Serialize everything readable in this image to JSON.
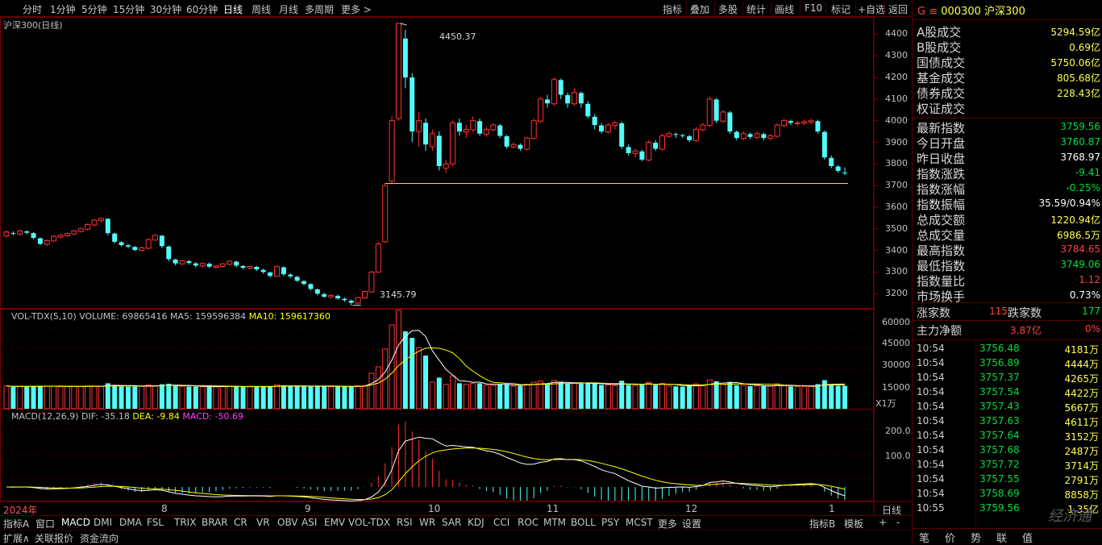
{
  "toolbar": {
    "periods": [
      "分时",
      "1分钟",
      "5分钟",
      "15分钟",
      "30分钟",
      "60分钟",
      "日线",
      "周线",
      "月线",
      "多周期",
      "更多"
    ],
    "active_period": "日线",
    "right_items": [
      "指标",
      "叠加",
      "多股",
      "统计",
      "画线",
      "F10",
      "标记",
      "+自选",
      "返回"
    ]
  },
  "chart": {
    "title": "沪深300(日线)",
    "high_label": "4450.37",
    "low_label": "3145.79",
    "price_ticks": [
      "4400",
      "4300",
      "4200",
      "4100",
      "4000",
      "3900",
      "3800",
      "3700",
      "3600",
      "3500",
      "3400",
      "3300",
      "3200"
    ],
    "vol_label": "VOL-TDX(5,10)",
    "vol_value": "VOLUME: 69865416",
    "ma5": "MA5: 159596384",
    "ma10": "MA10: 159617360",
    "vol_ticks": [
      "60000",
      "45000",
      "30000",
      "15000"
    ],
    "vol_unit": "X1万",
    "macd_label": "MACD(12,26,9)",
    "dif": "DIF: -35.18",
    "dea": "DEA: -9.84",
    "macd": "MACD: -50.69",
    "macd_ticks": [
      "200.0",
      "100.0"
    ],
    "x_labels": [
      "2024年",
      "8",
      "9",
      "10",
      "11",
      "12",
      "1"
    ],
    "x_period": "日线"
  },
  "chart_data": {
    "type": "candlestick",
    "ylim": [
      3100,
      4500
    ],
    "candles": [
      [
        3468,
        3485,
        3458,
        3492
      ],
      [
        3480,
        3478,
        3470,
        3488
      ],
      [
        3476,
        3490,
        3468,
        3495
      ],
      [
        3488,
        3482,
        3474,
        3492
      ],
      [
        3480,
        3458,
        3452,
        3484
      ],
      [
        3456,
        3430,
        3425,
        3460
      ],
      [
        3428,
        3445,
        3420,
        3450
      ],
      [
        3444,
        3465,
        3440,
        3470
      ],
      [
        3462,
        3470,
        3456,
        3476
      ],
      [
        3468,
        3478,
        3462,
        3482
      ],
      [
        3476,
        3490,
        3470,
        3495
      ],
      [
        3488,
        3500,
        3482,
        3505
      ],
      [
        3498,
        3520,
        3492,
        3525
      ],
      [
        3518,
        3540,
        3512,
        3545
      ],
      [
        3538,
        3548,
        3530,
        3552
      ],
      [
        3546,
        3480,
        3470,
        3550
      ],
      [
        3478,
        3440,
        3432,
        3482
      ],
      [
        3438,
        3425,
        3418,
        3442
      ],
      [
        3424,
        3418,
        3410,
        3430
      ],
      [
        3416,
        3402,
        3396,
        3420
      ],
      [
        3400,
        3412,
        3394,
        3418
      ],
      [
        3410,
        3450,
        3406,
        3455
      ],
      [
        3448,
        3470,
        3444,
        3475
      ],
      [
        3468,
        3420,
        3410,
        3472
      ],
      [
        3418,
        3360,
        3350,
        3422
      ],
      [
        3358,
        3340,
        3330,
        3362
      ],
      [
        3338,
        3352,
        3330,
        3356
      ],
      [
        3350,
        3342,
        3334,
        3356
      ],
      [
        3340,
        3330,
        3322,
        3346
      ],
      [
        3328,
        3340,
        3322,
        3344
      ],
      [
        3338,
        3325,
        3318,
        3344
      ],
      [
        3322,
        3328,
        3316,
        3332
      ],
      [
        3326,
        3338,
        3320,
        3342
      ],
      [
        3336,
        3350,
        3330,
        3355
      ],
      [
        3348,
        3330,
        3322,
        3352
      ],
      [
        3328,
        3320,
        3312,
        3332
      ],
      [
        3318,
        3326,
        3312,
        3330
      ],
      [
        3324,
        3312,
        3305,
        3328
      ],
      [
        3310,
        3300,
        3292,
        3316
      ],
      [
        3298,
        3282,
        3276,
        3302
      ],
      [
        3280,
        3325,
        3276,
        3330
      ],
      [
        3322,
        3290,
        3282,
        3326
      ],
      [
        3288,
        3280,
        3272,
        3294
      ],
      [
        3278,
        3260,
        3254,
        3282
      ],
      [
        3258,
        3245,
        3238,
        3262
      ],
      [
        3244,
        3222,
        3214,
        3248
      ],
      [
        3220,
        3200,
        3192,
        3224
      ],
      [
        3198,
        3186,
        3180,
        3204
      ],
      [
        3185,
        3192,
        3178,
        3198
      ],
      [
        3190,
        3178,
        3172,
        3196
      ],
      [
        3176,
        3170,
        3162,
        3182
      ],
      [
        3168,
        3158,
        3146,
        3172
      ],
      [
        3156,
        3182,
        3150,
        3186
      ],
      [
        3180,
        3210,
        3176,
        3214
      ],
      [
        3208,
        3300,
        3204,
        3305
      ],
      [
        3300,
        3430,
        3296,
        3440
      ],
      [
        3440,
        3700,
        3436,
        3710
      ],
      [
        3720,
        4000,
        3710,
        4020
      ],
      [
        4010,
        4450,
        4000,
        4450
      ],
      [
        4380,
        4200,
        4150,
        4420
      ],
      [
        4200,
        3950,
        3900,
        4220
      ],
      [
        3950,
        4000,
        3880,
        4040
      ],
      [
        3990,
        3890,
        3860,
        4010
      ],
      [
        3880,
        3940,
        3860,
        3960
      ],
      [
        3930,
        3790,
        3770,
        3950
      ],
      [
        3780,
        3800,
        3760,
        3820
      ],
      [
        3800,
        3990,
        3790,
        4000
      ],
      [
        3990,
        3950,
        3930,
        4010
      ],
      [
        3948,
        3960,
        3920,
        3980
      ],
      [
        3958,
        4000,
        3945,
        4020
      ],
      [
        3998,
        3940,
        3930,
        4010
      ],
      [
        3938,
        3960,
        3925,
        3970
      ],
      [
        3958,
        3980,
        3948,
        3990
      ],
      [
        3978,
        3930,
        3920,
        3985
      ],
      [
        3928,
        3880,
        3870,
        3935
      ],
      [
        3878,
        3890,
        3872,
        3900
      ],
      [
        3888,
        3870,
        3860,
        3895
      ],
      [
        3868,
        3920,
        3862,
        3925
      ],
      [
        3918,
        4000,
        3912,
        4010
      ],
      [
        3998,
        4100,
        3990,
        4110
      ],
      [
        4098,
        4080,
        4060,
        4120
      ],
      [
        4078,
        4190,
        4070,
        4200
      ],
      [
        4188,
        4120,
        4100,
        4195
      ],
      [
        4118,
        4080,
        4060,
        4130
      ],
      [
        4078,
        4130,
        4070,
        4150
      ],
      [
        4128,
        4080,
        4060,
        4135
      ],
      [
        4078,
        4020,
        4010,
        4090
      ],
      [
        4018,
        3980,
        3960,
        4030
      ],
      [
        3978,
        3950,
        3940,
        3990
      ],
      [
        3948,
        3980,
        3940,
        3990
      ],
      [
        3978,
        3990,
        3960,
        3998
      ],
      [
        3988,
        3880,
        3870,
        3995
      ],
      [
        3878,
        3850,
        3840,
        3890
      ],
      [
        3848,
        3860,
        3830,
        3870
      ],
      [
        3858,
        3820,
        3812,
        3866
      ],
      [
        3818,
        3900,
        3812,
        3910
      ],
      [
        3898,
        3870,
        3860,
        3910
      ],
      [
        3868,
        3930,
        3862,
        3940
      ],
      [
        3928,
        3940,
        3920,
        3950
      ],
      [
        3938,
        3935,
        3920,
        3945
      ],
      [
        3933,
        3930,
        3920,
        3940
      ],
      [
        3928,
        3910,
        3900,
        3935
      ],
      [
        3908,
        3960,
        3900,
        3970
      ],
      [
        3958,
        3980,
        3950,
        3990
      ],
      [
        3978,
        4100,
        3970,
        4110
      ],
      [
        4098,
        4000,
        3990,
        4105
      ],
      [
        3998,
        4040,
        3990,
        4050
      ],
      [
        4038,
        3950,
        3940,
        4045
      ],
      [
        3948,
        3920,
        3910,
        3955
      ],
      [
        3918,
        3940,
        3910,
        3950
      ],
      [
        3938,
        3925,
        3915,
        3945
      ],
      [
        3923,
        3940,
        3915,
        3950
      ],
      [
        3938,
        3920,
        3910,
        3945
      ],
      [
        3918,
        3930,
        3910,
        3940
      ],
      [
        3928,
        3980,
        3920,
        3990
      ],
      [
        3978,
        4000,
        3970,
        4010
      ],
      [
        3998,
        3990,
        3980,
        4005
      ],
      [
        3988,
        3990,
        3975,
        3998
      ],
      [
        3988,
        3995,
        3980,
        4005
      ],
      [
        3993,
        4000,
        3985,
        4010
      ],
      [
        3998,
        3950,
        3940,
        4005
      ],
      [
        3948,
        3830,
        3820,
        3955
      ],
      [
        3828,
        3790,
        3780,
        3840
      ],
      [
        3788,
        3768,
        3760,
        3795
      ],
      [
        3760,
        3759,
        3749,
        3784
      ]
    ]
  },
  "quote": {
    "code_prefix": "G ≡",
    "code": "000300",
    "name": "沪深300",
    "rows": [
      {
        "k": "A股成交",
        "v": "5294.59亿",
        "c": "yellow"
      },
      {
        "k": "B股成交",
        "v": "0.69亿",
        "c": "yellow"
      },
      {
        "k": "国债成交",
        "v": "5750.06亿",
        "c": "yellow"
      },
      {
        "k": "基金成交",
        "v": "805.68亿",
        "c": "yellow"
      },
      {
        "k": "债券成交",
        "v": "228.43亿",
        "c": "yellow"
      },
      {
        "k": "权证成交",
        "v": "",
        "c": "yellow"
      },
      {
        "k": "最新指数",
        "v": "3759.56",
        "c": "green"
      },
      {
        "k": "今日开盘",
        "v": "3760.87",
        "c": "green"
      },
      {
        "k": "昨日收盘",
        "v": "3768.97",
        "c": "white"
      },
      {
        "k": "指数涨跌",
        "v": "-9.41",
        "c": "green"
      },
      {
        "k": "指数涨幅",
        "v": "-0.25%",
        "c": "green"
      },
      {
        "k": "指数振幅",
        "v": "35.59/0.94%",
        "c": "white"
      },
      {
        "k": "总成交额",
        "v": "1220.94亿",
        "c": "yellow"
      },
      {
        "k": "总成交量",
        "v": "6986.5万",
        "c": "yellow"
      },
      {
        "k": "最高指数",
        "v": "3784.65",
        "c": "red"
      },
      {
        "k": "最低指数",
        "v": "3749.06",
        "c": "green"
      },
      {
        "k": "指数量比",
        "v": "1.12",
        "c": "red"
      },
      {
        "k": "市场换手",
        "v": "0.73%",
        "c": "white"
      }
    ],
    "rise_label": "涨家数",
    "rise_value": "115",
    "fall_label": "跌家数",
    "fall_value": "177",
    "main_label": "主力净额",
    "main_value": "3.87亿",
    "main_pct": "0%",
    "ticks": [
      {
        "t": "10:54",
        "p": "3756.48",
        "q": "4181万"
      },
      {
        "t": "10:54",
        "p": "3756.89",
        "q": "4444万"
      },
      {
        "t": "10:54",
        "p": "3757.37",
        "q": "4265万"
      },
      {
        "t": "10:54",
        "p": "3757.54",
        "q": "4422万"
      },
      {
        "t": "10:54",
        "p": "3757.43",
        "q": "5667万"
      },
      {
        "t": "10:54",
        "p": "3757.63",
        "q": "4611万"
      },
      {
        "t": "10:54",
        "p": "3757.64",
        "q": "3152万"
      },
      {
        "t": "10:54",
        "p": "3757.68",
        "q": "2487万"
      },
      {
        "t": "10:54",
        "p": "3757.72",
        "q": "3714万"
      },
      {
        "t": "10:54",
        "p": "3757.55",
        "q": "2791万"
      },
      {
        "t": "10:54",
        "p": "3758.69",
        "q": "8858万"
      },
      {
        "t": "10:55",
        "p": "3759.56",
        "q": "1.35亿"
      }
    ],
    "bottom_tabs": [
      "笔",
      "价",
      "势",
      "联",
      "值"
    ],
    "watermark": "经济通"
  },
  "indicator_tabs": [
    "指标A",
    "窗口",
    "MACD",
    "DMI",
    "DMA",
    "FSL",
    "TRIX",
    "BRAR",
    "CR",
    "VR",
    "OBV",
    "ASI",
    "EMV",
    "VOL-TDX",
    "RSI",
    "WR",
    "SAR",
    "KDJ",
    "CCI",
    "ROC",
    "MTM",
    "BOLL",
    "PSY",
    "MCST",
    "更多",
    "设置"
  ],
  "indicator_right": [
    "指标B",
    "模板",
    "+",
    "-"
  ],
  "bottom_row": [
    "扩展∧",
    "关联报价",
    "资金流向"
  ],
  "colors": {
    "up": "#ff3232",
    "down": "#54fcfc",
    "ma5": "#ffffff",
    "ma10": "#ffff00",
    "grid": "#7a0000"
  }
}
